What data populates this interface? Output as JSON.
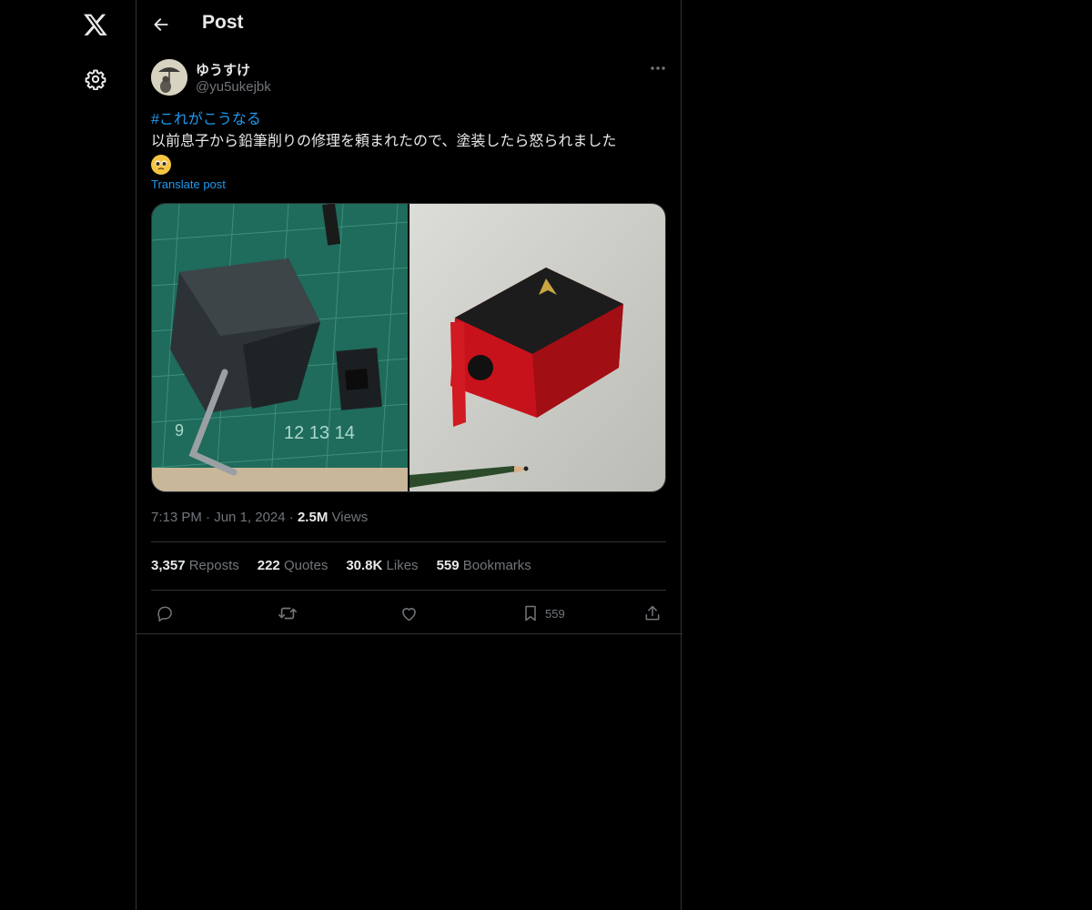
{
  "header": {
    "title": "Post"
  },
  "author": {
    "name": "ゆうすけ",
    "handle": "@yu5ukejbk"
  },
  "post": {
    "hashtag": "#これがこうなる",
    "text": "以前息子から鉛筆削りの修理を頼まれたので、塗装したら怒られました",
    "emoji": "pleading-face-emoji",
    "translate_label": "Translate post"
  },
  "meta": {
    "time": "7:13 PM",
    "date": "Jun 1, 2024",
    "views_count": "2.5M",
    "views_label": "Views"
  },
  "stats": [
    {
      "count": "3,357",
      "label": "Reposts"
    },
    {
      "count": "222",
      "label": "Quotes"
    },
    {
      "count": "30.8K",
      "label": "Likes"
    },
    {
      "count": "559",
      "label": "Bookmarks"
    }
  ],
  "actions": {
    "bookmark_count": "559"
  },
  "icons": [
    "x-logo-icon",
    "settings-icon",
    "back-arrow-icon",
    "more-icon",
    "reply-icon",
    "repost-icon",
    "like-icon",
    "bookmark-icon",
    "share-icon"
  ],
  "colors": {
    "background": "#000000",
    "accent": "#1d9bf0",
    "text": "#e7e9ea",
    "muted": "#71767b",
    "border": "#2f3336"
  }
}
